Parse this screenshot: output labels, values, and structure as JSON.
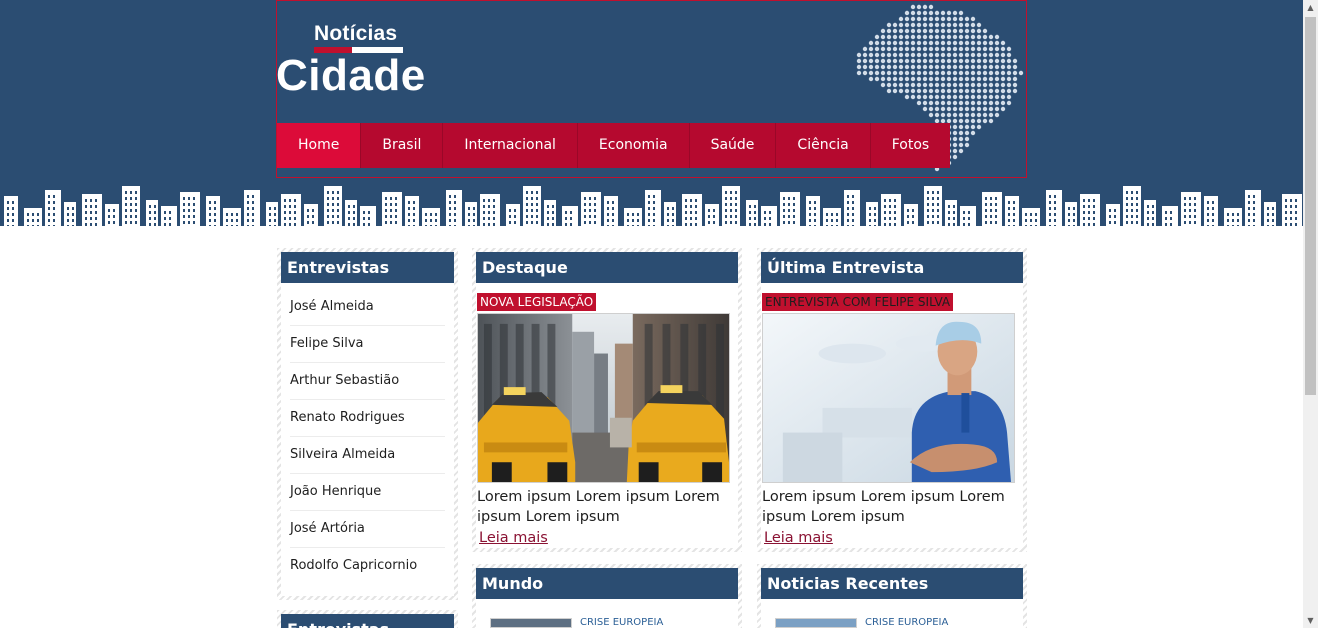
{
  "logo": {
    "top": "Notícias",
    "main": "Cidade"
  },
  "nav": [
    {
      "label": "Home",
      "active": true
    },
    {
      "label": "Brasil"
    },
    {
      "label": "Internacional"
    },
    {
      "label": "Economia"
    },
    {
      "label": "Saúde"
    },
    {
      "label": "Ciência"
    },
    {
      "label": "Fotos"
    }
  ],
  "sidebar": {
    "title": "Entrevistas",
    "items": [
      "José Almeida",
      "Felipe Silva",
      "Arthur Sebastião",
      "Renato Rodrigues",
      "Silveira Almeida",
      "João Henrique",
      "José Artória",
      "Rodolfo Capricornio"
    ],
    "second_title": "Entrevistas"
  },
  "featured": {
    "title": "Destaque",
    "tag": "NOVA LEGISLAÇÃO",
    "text": "Lorem ipsum Lorem ipsum Lorem ipsum Lorem ipsum",
    "link": "Leia mais"
  },
  "interview": {
    "title": "Última Entrevista",
    "tag": "ENTREVISTA COM FELIPE SILVA",
    "text": "Lorem ipsum Lorem ipsum Lorem ipsum Lorem ipsum",
    "link": "Leia mais"
  },
  "world": {
    "title": "Mundo",
    "tag": "CRISE EUROPEIA"
  },
  "recent": {
    "title": "Noticias Recentes",
    "tag": "CRISE EUROPEIA"
  },
  "colors": {
    "header": "#2b4d72",
    "nav": "#b5092f",
    "nav_active": "#dc0b39",
    "link": "#8a1233"
  },
  "icons": {
    "scroll_up": "triangle-up-icon",
    "scroll_down": "triangle-down-icon",
    "map": "brazil-map-icon"
  }
}
